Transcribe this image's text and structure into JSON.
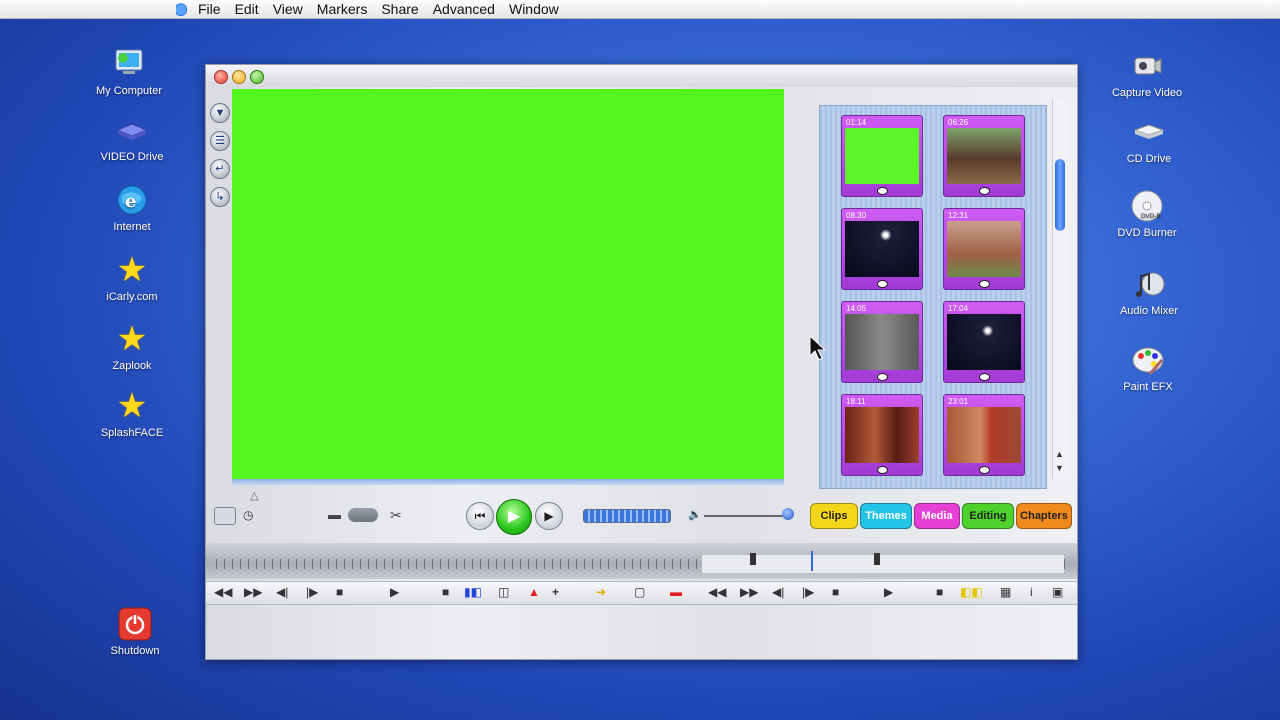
{
  "menubar": {
    "items": [
      "File",
      "Edit",
      "View",
      "Markers",
      "Share",
      "Advanced",
      "Window"
    ]
  },
  "desktop": {
    "left_icons": [
      {
        "label": "My Computer",
        "icon": "computer-icon"
      },
      {
        "label": "VIDEO Drive",
        "icon": "drive-icon"
      },
      {
        "label": "Internet",
        "icon": "globe-icon"
      },
      {
        "label": "iCarly.com",
        "icon": "star-icon"
      },
      {
        "label": "Zaplook",
        "icon": "star-icon"
      },
      {
        "label": "SplashFACE",
        "icon": "star-icon"
      },
      {
        "label": "Shutdown",
        "icon": "power-icon"
      }
    ],
    "right_icons": [
      {
        "label": "Capture Video",
        "icon": "camera-icon"
      },
      {
        "label": "CD Drive",
        "icon": "cd-drive-icon"
      },
      {
        "label": "DVD Burner",
        "icon": "dvd-icon"
      },
      {
        "label": "Audio Mixer",
        "icon": "audio-icon"
      },
      {
        "label": "Paint EFX",
        "icon": "paint-icon"
      }
    ]
  },
  "clips": [
    {
      "time": "01:14",
      "scene": "green"
    },
    {
      "time": "06:26",
      "scene": "building"
    },
    {
      "time": "08:30",
      "scene": "night"
    },
    {
      "time": "12:31",
      "scene": "building"
    },
    {
      "time": "14:05",
      "scene": "gray"
    },
    {
      "time": "17:04",
      "scene": "night"
    },
    {
      "time": "18:11",
      "scene": "girls"
    },
    {
      "time": "23:01",
      "scene": "guy"
    }
  ],
  "tabs": [
    {
      "label": "Clips",
      "color": "#f3d51a",
      "text": "#222"
    },
    {
      "label": "Themes",
      "color": "#22c4e8",
      "text": "#fff"
    },
    {
      "label": "Media",
      "color": "#e63fd6",
      "text": "#fff"
    },
    {
      "label": "Editing",
      "color": "#4fd12c",
      "text": "#222"
    },
    {
      "label": "Chapters",
      "color": "#f08a1c",
      "text": "#222"
    }
  ],
  "colors": {
    "viewer_screen": "#54f51c",
    "panel_bg": "#b2c8ea"
  }
}
